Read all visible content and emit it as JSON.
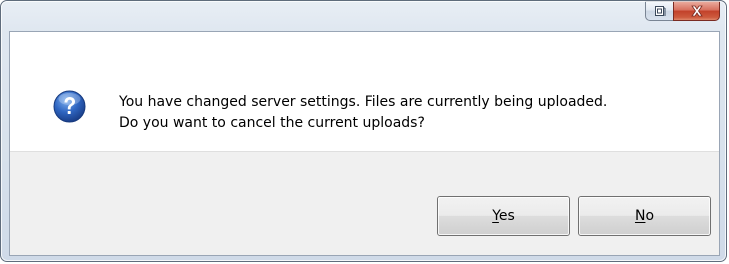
{
  "window": {
    "accent_color": "#c2412a",
    "frame_color": "#d7e1ec"
  },
  "caption_buttons": {
    "restore_icon": "restore-icon",
    "close_icon": "close-icon"
  },
  "dialog": {
    "icon": "question-icon",
    "icon_color": "#2a5db0",
    "message_line1": "You have changed server settings. Files are currently being uploaded.",
    "message_line2": "Do you want to cancel the current uploads?"
  },
  "buttons": {
    "yes": {
      "mnemonic": "Y",
      "rest": "es"
    },
    "no": {
      "mnemonic": "N",
      "rest": "o"
    }
  }
}
